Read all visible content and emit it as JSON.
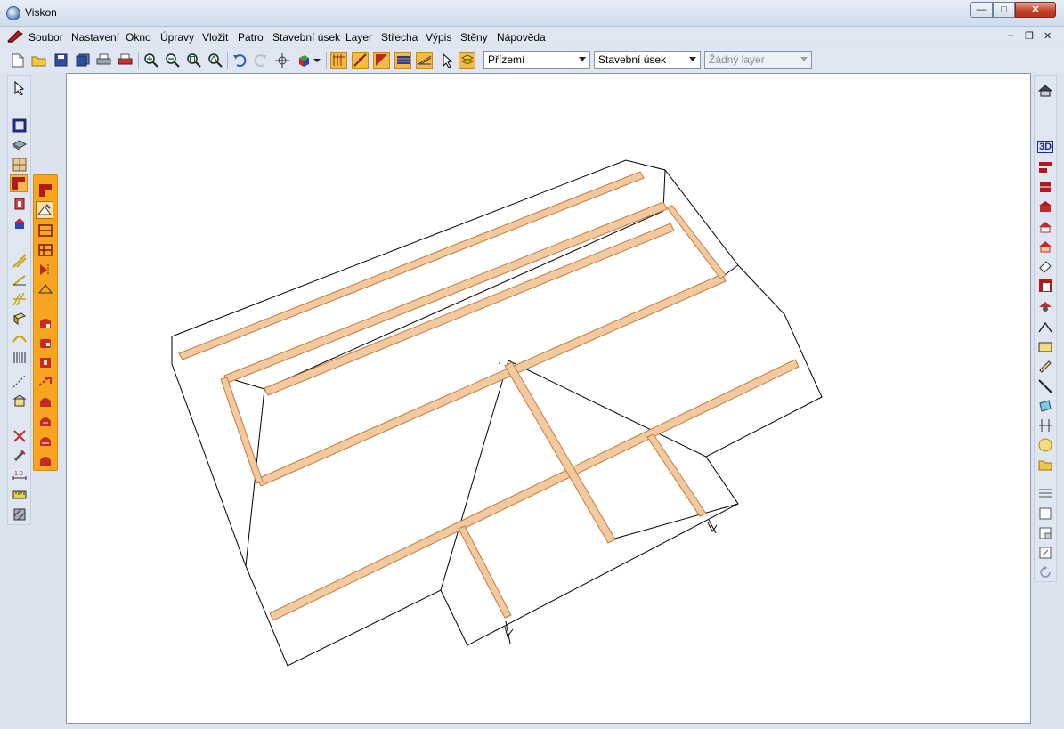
{
  "window": {
    "title": "Viskon",
    "controls": {
      "minimize": "—",
      "maximize": "□",
      "close": "✕"
    }
  },
  "menu": {
    "items": [
      "Soubor",
      "Nastavení",
      "Okno",
      "Úpravy",
      "Vložit",
      "Patro",
      "Stavební úsek",
      "Layer",
      "Střecha",
      "Výpis",
      "Stěny",
      "Nápověda"
    ],
    "mdi_controls": {
      "minimize": "–",
      "restore": "❐",
      "close": "✕"
    }
  },
  "toolbar": {
    "combo_floor": {
      "value": "Přízemí"
    },
    "combo_section": {
      "value": "Stavební úsek"
    },
    "combo_layer": {
      "value": "Žádný layer",
      "disabled": true
    },
    "icons": [
      "new-file-icon",
      "open-folder-icon",
      "save-icon",
      "save-all-icon",
      "print-icon",
      "print-preview-icon",
      "zoom-in-icon",
      "zoom-out-icon",
      "zoom-window-icon",
      "zoom-all-icon",
      "undo-icon",
      "redo-icon",
      "pan-icon",
      "render-3d-icon",
      "rafter-grid-icon",
      "roof-snap-icon",
      "roof-plane-icon",
      "roof-cover-icon",
      "truss-icon",
      "pointer-icon",
      "layer-stack-icon"
    ]
  },
  "right_palette": {
    "labels": {
      "view3d": "3D"
    }
  },
  "colors": {
    "accent_orange": "#f7a41e",
    "beam_fill": "#f3c9a0",
    "beam_edge": "#c47a3a",
    "canvas": "#ffffff",
    "line": "#000000"
  }
}
